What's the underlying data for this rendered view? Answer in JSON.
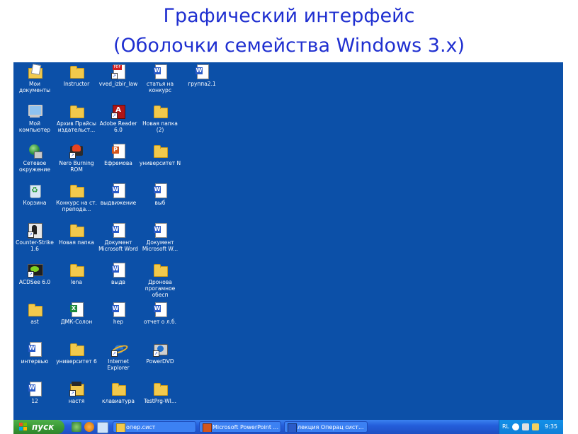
{
  "slide": {
    "title_line1": "Графический интерфейс",
    "title_line2": "(Оболочки семейства Windows 3.x)"
  },
  "desktop": {
    "icons": [
      {
        "label": "Мои документы",
        "icon": "my-documents-icon"
      },
      {
        "label": "Instructor",
        "icon": "folder-icon"
      },
      {
        "label": "vved_izbir_law",
        "icon": "pdf-document-icon"
      },
      {
        "label": "статья на конкурс",
        "icon": "word-document-icon"
      },
      {
        "label": "группа2.1",
        "icon": "word-document-icon"
      },
      {
        "label": "Мой компьютер",
        "icon": "my-computer-icon"
      },
      {
        "label": "Архив Прайсы издательст...",
        "icon": "folder-icon"
      },
      {
        "label": "Adobe Reader 6.0",
        "icon": "adobe-reader-icon"
      },
      {
        "label": "Новая папка (2)",
        "icon": "folder-icon"
      },
      {
        "label": "Сетевое окружение",
        "icon": "network-icon"
      },
      {
        "label": "Nero Burning ROM",
        "icon": "nero-icon"
      },
      {
        "label": "Ефремова",
        "icon": "powerpoint-document-icon"
      },
      {
        "label": "университет N",
        "icon": "folder-icon"
      },
      {
        "label": "Корзина",
        "icon": "recycle-bin-icon"
      },
      {
        "label": "Конкурс на ст. препода...",
        "icon": "folder-icon"
      },
      {
        "label": "выдвижение",
        "icon": "word-document-icon"
      },
      {
        "label": "выб",
        "icon": "word-document-icon"
      },
      {
        "label": "Counter-Strike 1.6",
        "icon": "counter-strike-icon"
      },
      {
        "label": "Новая папка",
        "icon": "folder-icon"
      },
      {
        "label": "Документ Microsoft Word",
        "icon": "word-document-icon"
      },
      {
        "label": "Документ Microsoft W...",
        "icon": "word-document-icon"
      },
      {
        "label": "ACDSee 6.0",
        "icon": "acdsee-icon"
      },
      {
        "label": "lena",
        "icon": "folder-icon"
      },
      {
        "label": "выдв",
        "icon": "word-document-icon"
      },
      {
        "label": "Дронова прогамное обесп",
        "icon": "folder-icon"
      },
      {
        "label": "ast",
        "icon": "folder-icon"
      },
      {
        "label": "ДМК-Солон",
        "icon": "excel-document-icon"
      },
      {
        "label": "hep",
        "icon": "word-document-icon"
      },
      {
        "label": "отчет о л.б.",
        "icon": "word-document-icon"
      },
      {
        "label": "интервью",
        "icon": "word-document-icon"
      },
      {
        "label": "университет 6",
        "icon": "folder-icon"
      },
      {
        "label": "Internet Explorer",
        "icon": "internet-explorer-icon"
      },
      {
        "label": "PowerDVD",
        "icon": "powerdvd-icon"
      },
      {
        "label": "12",
        "icon": "word-document-icon"
      },
      {
        "label": "настя",
        "icon": "nastya-app-icon"
      },
      {
        "label": "клавиатура",
        "icon": "folder-icon"
      },
      {
        "label": "TestPrg-WI...",
        "icon": "folder-icon"
      }
    ],
    "background_color": "#0c50a8"
  },
  "taskbar": {
    "start_label": "пуск",
    "tasks": [
      {
        "label": "опер.сист",
        "icon": "folder-icon"
      },
      {
        "label": "Microsoft PowerPoint ...",
        "icon": "powerpoint-icon"
      },
      {
        "label": "лекция Операц сист...",
        "icon": "word-icon"
      }
    ],
    "tray": {
      "language": "RL",
      "clock": "9:35"
    }
  }
}
